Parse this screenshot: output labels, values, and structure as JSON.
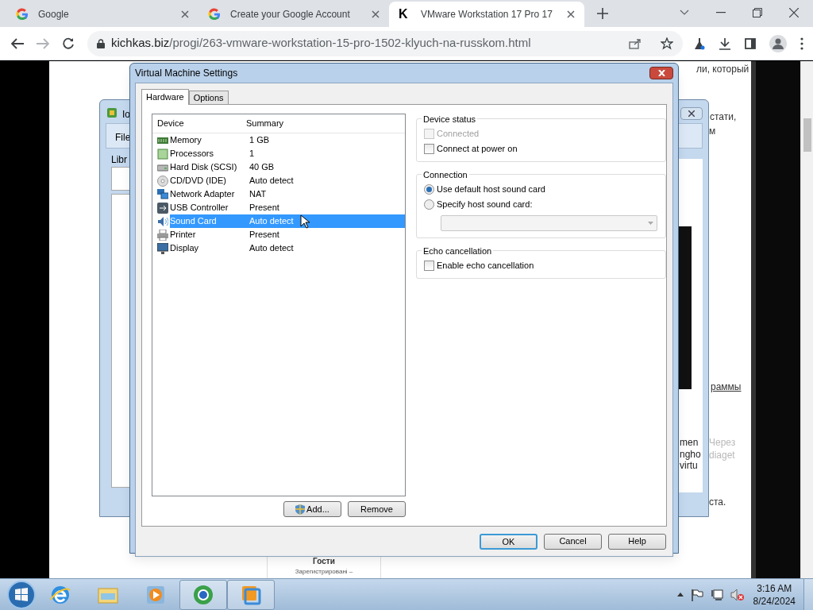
{
  "browser": {
    "tabs": [
      {
        "label": "Google",
        "kind": "google",
        "selected": false
      },
      {
        "label": "Create your Google Account",
        "kind": "google",
        "selected": false
      },
      {
        "label": "VMware Workstation 17 Pro 17",
        "kind": "letter",
        "favicon_text": "K",
        "selected": true
      }
    ],
    "url_host": "kichkas.biz",
    "url_path": "/progi/263-vmware-workstation-15-pro-1502-klyuch-na-russkom.html"
  },
  "page_text": {
    "line_1": "ли, который",
    "line_2": "стати,",
    "line_3": "м",
    "link": "раммы",
    "faded_1": "Через",
    "faded_2": "diaget",
    "line_4": "ста.",
    "guests_title": "Гости",
    "guests_subtitle": "Зарегистрировані –"
  },
  "background_window": {
    "title": "Io",
    "menu": "File",
    "library_label": "Libr",
    "text_1": "men",
    "text_2": "ngho",
    "text_3": "virtu"
  },
  "dialog": {
    "title": "Virtual Machine Settings",
    "tabs": [
      {
        "label": "Hardware",
        "selected": true
      },
      {
        "label": "Options",
        "selected": false
      }
    ],
    "columns": [
      "Device",
      "Summary"
    ],
    "devices": [
      {
        "kind": "memory",
        "name": "Memory",
        "summary": "1 GB",
        "selected": false
      },
      {
        "kind": "processor",
        "name": "Processors",
        "summary": "1",
        "selected": false
      },
      {
        "kind": "disk",
        "name": "Hard Disk (SCSI)",
        "summary": "40 GB",
        "selected": false
      },
      {
        "kind": "cd",
        "name": "CD/DVD (IDE)",
        "summary": "Auto detect",
        "selected": false
      },
      {
        "kind": "network",
        "name": "Network Adapter",
        "summary": "NAT",
        "selected": false
      },
      {
        "kind": "usb",
        "name": "USB Controller",
        "summary": "Present",
        "selected": false
      },
      {
        "kind": "sound",
        "name": "Sound Card",
        "summary": "Auto detect",
        "selected": true
      },
      {
        "kind": "printer",
        "name": "Printer",
        "summary": "Present",
        "selected": false
      },
      {
        "kind": "display",
        "name": "Display",
        "summary": "Auto detect",
        "selected": false
      }
    ],
    "list_buttons": [
      "Add...",
      "Remove"
    ],
    "groups": [
      {
        "title": "Device status",
        "items": [
          {
            "kind": "checkbox",
            "label": "Connected",
            "checked": false,
            "disabled": true
          },
          {
            "kind": "checkbox",
            "label": "Connect at power on",
            "checked": false,
            "disabled": false
          }
        ]
      },
      {
        "title": "Connection",
        "items": [
          {
            "kind": "radio",
            "label": "Use default host sound card",
            "selected": true
          },
          {
            "kind": "radio",
            "label": "Specify host sound card:",
            "selected": false
          },
          {
            "kind": "dropdown",
            "disabled": true
          }
        ]
      },
      {
        "title": "Echo cancellation",
        "items": [
          {
            "kind": "checkbox",
            "label": "Enable echo cancellation",
            "checked": false,
            "disabled": false
          }
        ]
      }
    ],
    "footer_buttons": [
      {
        "label": "OK",
        "default": true
      },
      {
        "label": "Cancel",
        "default": false
      },
      {
        "label": "Help",
        "default": false
      }
    ]
  },
  "taskbar": {
    "apps": [
      {
        "kind": "ie",
        "running": false
      },
      {
        "kind": "explorer",
        "running": false
      },
      {
        "kind": "media",
        "running": false
      },
      {
        "kind": "chrome",
        "running": true
      },
      {
        "kind": "vmware",
        "running": true
      }
    ],
    "time": "3:16 AM",
    "date": "8/24/2024"
  }
}
